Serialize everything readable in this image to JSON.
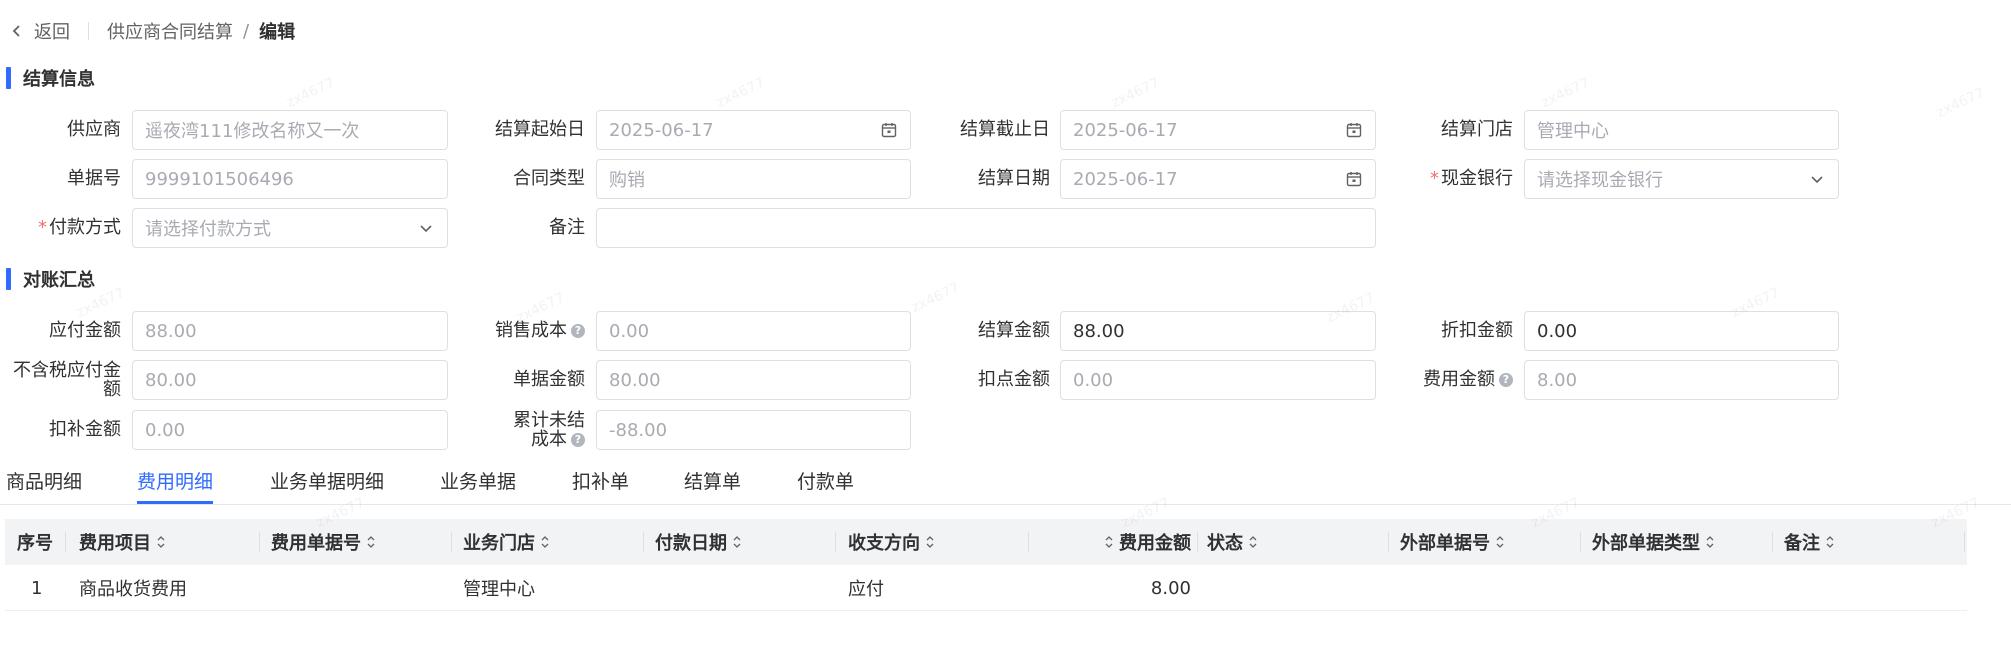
{
  "breadcrumb": {
    "back_label": "返回",
    "parent": "供应商合同结算",
    "separator": "/",
    "current": "编辑"
  },
  "settlement_info": {
    "title": "结算信息",
    "supplier": {
      "label": "供应商",
      "value": "遥夜湾111修改名称又一次"
    },
    "start_date": {
      "label": "结算起始日",
      "value": "2025-06-17"
    },
    "end_date": {
      "label": "结算截止日",
      "value": "2025-06-17"
    },
    "store": {
      "label": "结算门店",
      "value": "管理中心"
    },
    "doc_no": {
      "label": "单据号",
      "value": "9999101506496"
    },
    "contract_type": {
      "label": "合同类型",
      "value": "购销"
    },
    "settle_date": {
      "label": "结算日期",
      "value": "2025-06-17"
    },
    "cash_bank": {
      "label": "现金银行",
      "required_mark": "*",
      "placeholder": "请选择现金银行"
    },
    "payment_method": {
      "label": "付款方式",
      "required_mark": "*",
      "placeholder": "请选择付款方式"
    },
    "remark": {
      "label": "备注",
      "value": ""
    }
  },
  "reconciliation": {
    "title": "对账汇总",
    "payable": {
      "label": "应付金额",
      "value": "88.00"
    },
    "sales_cost": {
      "label": "销售成本",
      "value": "0.00"
    },
    "settle_amount": {
      "label": "结算金额",
      "value": "88.00"
    },
    "discount_amount": {
      "label": "折扣金额",
      "value": "0.00"
    },
    "payable_ex_tax": {
      "label_line1": "不含税应付金",
      "label_line2": "额",
      "value": "80.00"
    },
    "doc_amount": {
      "label": "单据金额",
      "value": "80.00"
    },
    "deduction_amount": {
      "label": "扣点金额",
      "value": "0.00"
    },
    "fee_amount": {
      "label": "费用金额",
      "value": "8.00"
    },
    "supplement_amount": {
      "label": "扣补金额",
      "value": "0.00"
    },
    "unsettled_cost": {
      "label_line1": "累计未结",
      "label_line2": "成本",
      "value": "-88.00"
    },
    "help_glyph": "?"
  },
  "tabs": [
    {
      "label": "商品明细"
    },
    {
      "label": "费用明细"
    },
    {
      "label": "业务单据明细"
    },
    {
      "label": "业务单据"
    },
    {
      "label": "扣补单"
    },
    {
      "label": "结算单"
    },
    {
      "label": "付款单"
    }
  ],
  "active_tab": "费用明细",
  "table": {
    "headers": [
      "序号",
      "费用项目",
      "费用单据号",
      "业务门店",
      "付款日期",
      "收支方向",
      "费用金额",
      "状态",
      "外部单据号",
      "外部单据类型",
      "备注"
    ],
    "rows": [
      {
        "index": "1",
        "fee_item": "商品收货费用",
        "fee_doc_no": "",
        "store": "管理中心",
        "pay_date": "",
        "direction": "应付",
        "amount": "8.00",
        "status": "",
        "ext_no": "",
        "ext_type": "",
        "remark": ""
      }
    ]
  },
  "colors": {
    "accent": "#2f6bff",
    "required": "#f56c6c"
  },
  "watermark": "zx4677"
}
